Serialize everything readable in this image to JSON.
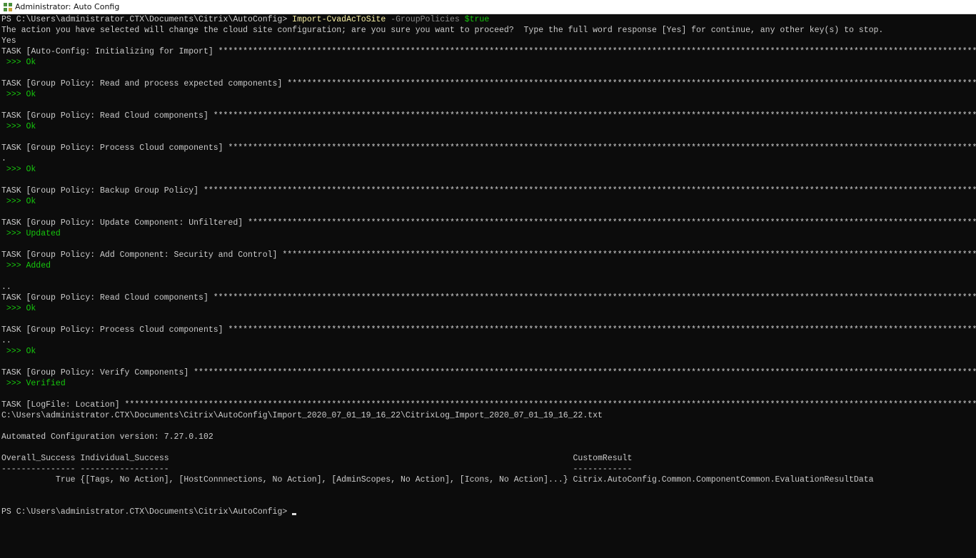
{
  "window": {
    "title": "Administrator: Auto Config",
    "icon": "console-icon"
  },
  "colors": {
    "background": "#0c0c0c",
    "text": "#cccccc",
    "command": "#f9f1a5",
    "parameter": "#8a8a8a",
    "success": "#16c60c"
  },
  "star_fill": "*",
  "lines": [
    {
      "segments": [
        {
          "t": "PS C:\\Users\\administrator.CTX\\Documents\\Citrix\\AutoConfig> "
        },
        {
          "t": "Import-CvadAcToSite",
          "c": "yellow"
        },
        {
          "t": " -GroupPolicies ",
          "c": "gray"
        },
        {
          "t": "$true",
          "c": "green"
        }
      ]
    },
    {
      "segments": [
        {
          "t": "The action you have selected will change the cloud site configuration; are you sure you want to proceed?  Type the full word response [Yes] for continue, any other key(s) to stop."
        }
      ]
    },
    {
      "segments": [
        {
          "t": "Yes"
        }
      ]
    },
    {
      "segments": [
        {
          "t": "TASK [Auto-Config: Initializing for Import] "
        }
      ],
      "stars": true
    },
    {
      "segments": [
        {
          "t": " >>> Ok",
          "c": "green"
        }
      ]
    },
    {
      "segments": []
    },
    {
      "segments": [
        {
          "t": "TASK [Group Policy: Read and process expected components] "
        }
      ],
      "stars": true
    },
    {
      "segments": [
        {
          "t": " >>> Ok",
          "c": "green"
        }
      ]
    },
    {
      "segments": []
    },
    {
      "segments": [
        {
          "t": "TASK [Group Policy: Read Cloud components] "
        }
      ],
      "stars": true
    },
    {
      "segments": [
        {
          "t": " >>> Ok",
          "c": "green"
        }
      ]
    },
    {
      "segments": []
    },
    {
      "segments": [
        {
          "t": "TASK [Group Policy: Process Cloud components] "
        }
      ],
      "stars": true
    },
    {
      "segments": [
        {
          "t": "."
        }
      ]
    },
    {
      "segments": [
        {
          "t": " >>> Ok",
          "c": "green"
        }
      ]
    },
    {
      "segments": []
    },
    {
      "segments": [
        {
          "t": "TASK [Group Policy: Backup Group Policy] "
        }
      ],
      "stars": true
    },
    {
      "segments": [
        {
          "t": " >>> Ok",
          "c": "green"
        }
      ]
    },
    {
      "segments": []
    },
    {
      "segments": [
        {
          "t": "TASK [Group Policy: Update Component: Unfiltered] "
        }
      ],
      "stars": true
    },
    {
      "segments": [
        {
          "t": " >>> Updated",
          "c": "green"
        }
      ]
    },
    {
      "segments": []
    },
    {
      "segments": [
        {
          "t": "TASK [Group Policy: Add Component: Security and Control] "
        }
      ],
      "stars": true
    },
    {
      "segments": [
        {
          "t": " >>> Added",
          "c": "green"
        }
      ]
    },
    {
      "segments": []
    },
    {
      "segments": [
        {
          "t": ".."
        }
      ]
    },
    {
      "segments": [
        {
          "t": "TASK [Group Policy: Read Cloud components] "
        }
      ],
      "stars": true
    },
    {
      "segments": [
        {
          "t": " >>> Ok",
          "c": "green"
        }
      ]
    },
    {
      "segments": []
    },
    {
      "segments": [
        {
          "t": "TASK [Group Policy: Process Cloud components] "
        }
      ],
      "stars": true
    },
    {
      "segments": [
        {
          "t": ".."
        }
      ]
    },
    {
      "segments": [
        {
          "t": " >>> Ok",
          "c": "green"
        }
      ]
    },
    {
      "segments": []
    },
    {
      "segments": [
        {
          "t": "TASK [Group Policy: Verify Components] "
        }
      ],
      "stars": true
    },
    {
      "segments": [
        {
          "t": " >>> Verified",
          "c": "green"
        }
      ]
    },
    {
      "segments": []
    },
    {
      "segments": [
        {
          "t": "TASK [LogFile: Location] "
        }
      ],
      "stars": true
    },
    {
      "segments": [
        {
          "t": "C:\\Users\\administrator.CTX\\Documents\\Citrix\\AutoConfig\\Import_2020_07_01_19_16_22\\CitrixLog_Import_2020_07_01_19_16_22.txt"
        }
      ]
    },
    {
      "segments": []
    },
    {
      "segments": [
        {
          "t": "Automated Configuration version: 7.27.0.102"
        }
      ]
    },
    {
      "segments": []
    },
    {
      "segments": [
        {
          "t": "Overall_Success Individual_Success                                                                                  CustomResult"
        }
      ]
    },
    {
      "segments": [
        {
          "t": "--------------- ------------------                                                                                  ------------"
        }
      ]
    },
    {
      "segments": [
        {
          "t": "           True {[Tags, No Action], [HostConnnections, No Action], [AdminScopes, No Action], [Icons, No Action]...} Citrix.AutoConfig.Common.ComponentCommon.EvaluationResultData"
        }
      ]
    },
    {
      "segments": []
    },
    {
      "segments": []
    },
    {
      "segments": [
        {
          "t": "PS C:\\Users\\administrator.CTX\\Documents\\Citrix\\AutoConfig> "
        }
      ],
      "cursor": true
    }
  ]
}
